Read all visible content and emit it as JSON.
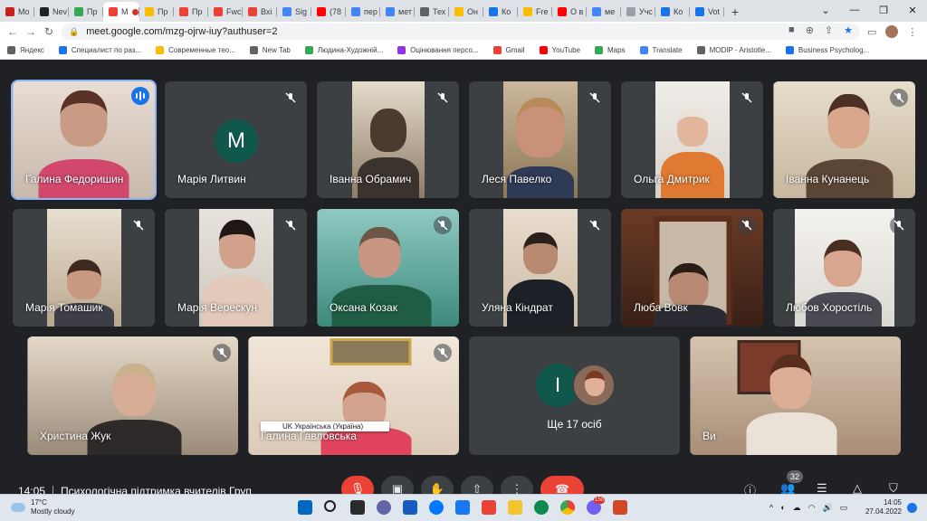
{
  "browser": {
    "tabs": [
      {
        "label": "Mo",
        "color": "#c5221f"
      },
      {
        "label": "Nev",
        "color": "#202124"
      },
      {
        "label": "Пр",
        "color": "#34a853"
      },
      {
        "label": "M",
        "color": "#ea4335",
        "active": true,
        "recording": true
      },
      {
        "label": "Пр",
        "color": "#fbbc04"
      },
      {
        "label": "Пр",
        "color": "#ea4335"
      },
      {
        "label": "Fwc",
        "color": "#ea4335"
      },
      {
        "label": "Вхі",
        "color": "#ea4335"
      },
      {
        "label": "Sig",
        "color": "#4285f4"
      },
      {
        "label": "(78",
        "color": "#ff0000"
      },
      {
        "label": "пер",
        "color": "#4285f4"
      },
      {
        "label": "мет",
        "color": "#4285f4"
      },
      {
        "label": "Тех",
        "color": "#5f6368"
      },
      {
        "label": "Он",
        "color": "#fbbc04"
      },
      {
        "label": "Ко",
        "color": "#1a73e8"
      },
      {
        "label": "Fre",
        "color": "#fbbc04"
      },
      {
        "label": "О в",
        "color": "#ff0000"
      },
      {
        "label": "ме",
        "color": "#4285f4"
      },
      {
        "label": "Учс",
        "color": "#9aa0a6"
      },
      {
        "label": "Ко",
        "color": "#1a73e8"
      },
      {
        "label": "Vot",
        "color": "#1a73e8"
      }
    ],
    "new_tab": "+",
    "url": "meet.google.com/mzg-ojrw-iuy?authuser=2",
    "bookmarks": [
      {
        "label": "Яндекс",
        "color": "#5f6368"
      },
      {
        "label": "Специалист по раз...",
        "color": "#1a73e8"
      },
      {
        "label": "Современные тео...",
        "color": "#fbbc04"
      },
      {
        "label": "New Tab",
        "color": "#5f6368"
      },
      {
        "label": "Людина-Художній...",
        "color": "#34a853"
      },
      {
        "label": "Оцінювання персо...",
        "color": "#9334e6"
      },
      {
        "label": "Gmail",
        "color": "#ea4335"
      },
      {
        "label": "YouTube",
        "color": "#ff0000"
      },
      {
        "label": "Maps",
        "color": "#34a853"
      },
      {
        "label": "Translate",
        "color": "#4285f4"
      },
      {
        "label": "MODIP - Aristotle...",
        "color": "#5f6368"
      },
      {
        "label": "Business Psycholog...",
        "color": "#1a73e8"
      }
    ]
  },
  "participants": [
    {
      "name": "Галина Федоришин",
      "speaking": true,
      "muted": false
    },
    {
      "name": "Марія Литвин",
      "muted": true,
      "avatar_letter": "M"
    },
    {
      "name": "Іванна Обрамич",
      "muted": true
    },
    {
      "name": "Леся Павелко",
      "muted": true
    },
    {
      "name": "Ольга Дмитрик",
      "muted": true
    },
    {
      "name": "Іванна Кунанець",
      "muted": true
    },
    {
      "name": "Марія Томашик",
      "muted": true
    },
    {
      "name": "Марія Верескун",
      "muted": true
    },
    {
      "name": "Оксана Козак",
      "muted": true
    },
    {
      "name": "Уляна Кіндрат",
      "muted": true
    },
    {
      "name": "Люба Вовк",
      "muted": true
    },
    {
      "name": "Любов Хоростіль",
      "muted": true
    },
    {
      "name": "Христина Жук",
      "muted": true
    },
    {
      "name": "Галина Гавловська",
      "muted": true
    },
    {
      "name": "Ще 17 осіб",
      "avatar_letter": "I"
    },
    {
      "name": "Ви"
    }
  ],
  "language_popup": "UK Українська (Україна)",
  "meeting": {
    "time": "14:05",
    "title": "Психологічна підтримка вчителів Груп",
    "participant_count": "32"
  },
  "taskbar": {
    "temperature": "17°C",
    "weather": "Mostly cloudy",
    "time": "14:05",
    "date": "27.04.2022",
    "badge": "150"
  }
}
